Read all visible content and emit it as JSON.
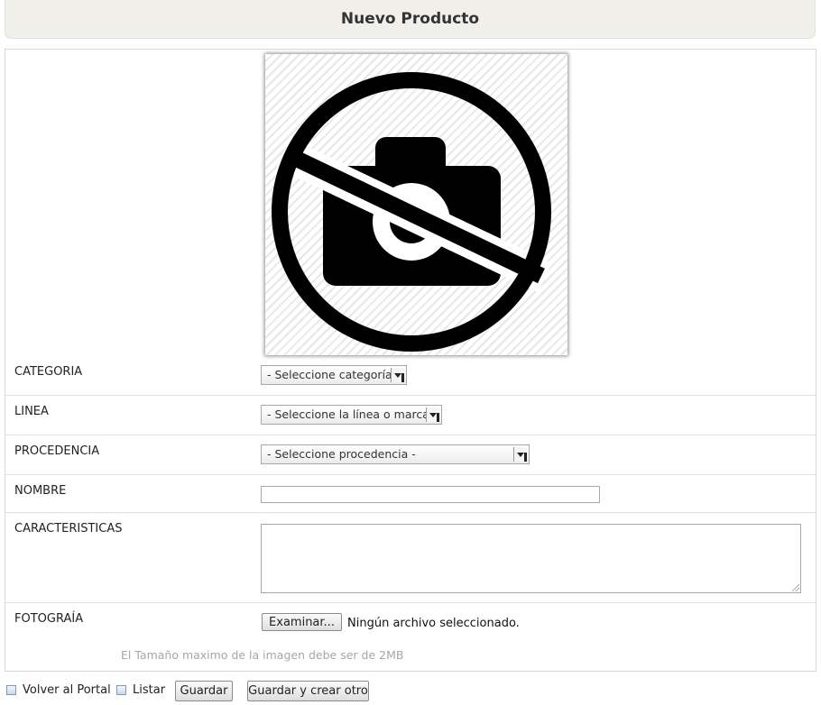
{
  "header": {
    "title": "Nuevo Producto"
  },
  "photo": {
    "icon": "no-photo-icon"
  },
  "form": {
    "categoria": {
      "label": "CATEGORIA",
      "selected": "- Seleccione categoría -"
    },
    "linea": {
      "label": "LINEA",
      "selected": "- Seleccione la línea o marca -"
    },
    "procedencia": {
      "label": "PROCEDENCIA",
      "selected": "- Seleccione procedencia -"
    },
    "nombre": {
      "label": "NOMBRE",
      "value": ""
    },
    "caracteristicas": {
      "label": "CARACTERISTICAS",
      "value": ""
    },
    "fotografia": {
      "label": "FOTOGRAÍA",
      "browse_label": "Examinar...",
      "status": "Ningún archivo seleccionado.",
      "hint": "El Tamaño maximo de la imagen debe ser de 2MB"
    }
  },
  "footer": {
    "back_label": "Volver al Portal",
    "list_label": "Listar",
    "save_label": "Guardar",
    "save_new_label": "Guardar y crear otro"
  }
}
